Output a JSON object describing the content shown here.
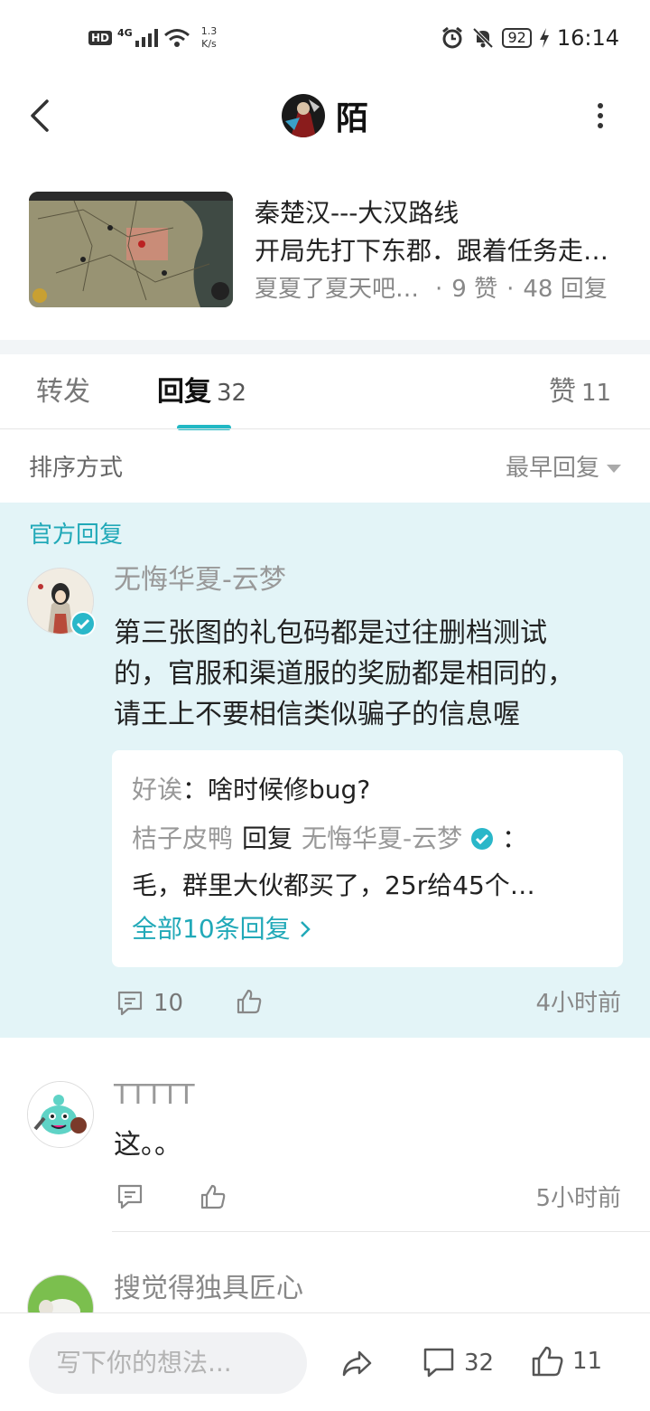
{
  "status_bar": {
    "hd": "HD",
    "signal": "4G",
    "net_speed_value": "1.3",
    "net_speed_unit": "K/s",
    "battery": "92",
    "time": "16:14"
  },
  "header": {
    "title": "陌"
  },
  "post": {
    "title": "秦楚汉---大汉路线",
    "subtitle": "开局先打下东郡．跟着任务走…",
    "author": "夏夏了夏天吧吧吧",
    "likes": "9 赞",
    "replies": "48 回复",
    "dot": "·"
  },
  "tabs": {
    "forward": "转发",
    "reply": "回复",
    "reply_count": "32",
    "like": "赞",
    "like_count": "11"
  },
  "sort": {
    "label": "排序方式",
    "value": "最早回复"
  },
  "official": {
    "label": "官方回复",
    "name": "无悔华夏-云梦",
    "lines": [
      "第三张图的礼包码都是过往删档测试",
      "的，官服和渠道服的奖励都是相同的，",
      "请王上不要相信类似骗子的信息喔"
    ],
    "replies": {
      "r1_name": "好诶",
      "r1_sep": "：",
      "r1_text": "啥时候修bug?",
      "r2_name": "桔子皮鸭",
      "r2_mid": "回复",
      "r2_target": "无悔华夏-云梦",
      "r2_sep": "：",
      "r2_text": "毛，群里大伙都买了，25r给45个…",
      "all": "全部10条回复"
    },
    "comment_count": "10",
    "time": "4小时前"
  },
  "comments": [
    {
      "name": "TTTTT",
      "text": "这。。",
      "time": "5小时前"
    },
    {
      "name": "搜觉得独具匠心"
    }
  ],
  "bottom_bar": {
    "placeholder": "写下你的想法...",
    "comment_count": "32",
    "like_count": "11"
  },
  "colors": {
    "accent": "#21b8c4",
    "official_bg": "#e3f4f7"
  }
}
